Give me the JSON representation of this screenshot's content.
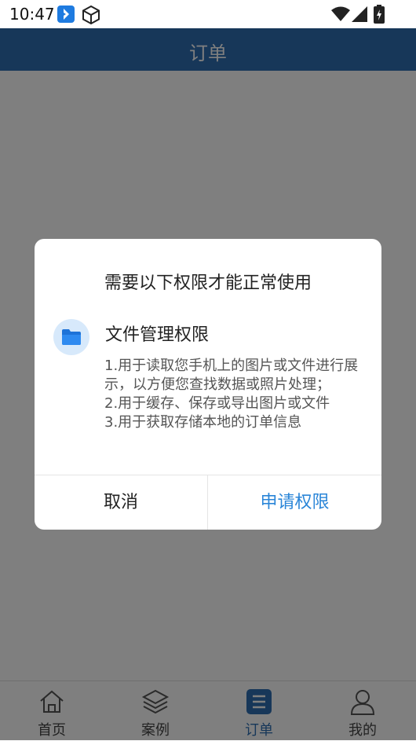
{
  "status_bar": {
    "time": "10:47",
    "icons": [
      "app-icon-blue",
      "package-icon",
      "wifi-icon",
      "signal-icon",
      "battery-icon"
    ]
  },
  "header": {
    "title": "订单"
  },
  "tabbar": {
    "tabs": [
      {
        "label": "首页",
        "icon": "home-icon"
      },
      {
        "label": "案例",
        "icon": "layers-icon"
      },
      {
        "label": "订单",
        "icon": "order-list-icon",
        "active": true
      },
      {
        "label": "我的",
        "icon": "user-icon"
      }
    ]
  },
  "dialog": {
    "title": "需要以下权限才能正常使用",
    "permission": {
      "icon": "folder-icon",
      "name": "文件管理权限",
      "description": [
        "1.用于读取您手机上的图片或文件进行展示，以方便您查找数据或照片处理；",
        "2.用于缓存、保存或导出图片或文件",
        "3.用于获取存储本地的订单信息"
      ]
    },
    "buttons": {
      "cancel": "取消",
      "request": "申请权限"
    }
  },
  "colors": {
    "header_bg": "#2f6fb3",
    "accent": "#2b86d8",
    "overlay": "rgba(0,0,0,0.5)"
  }
}
